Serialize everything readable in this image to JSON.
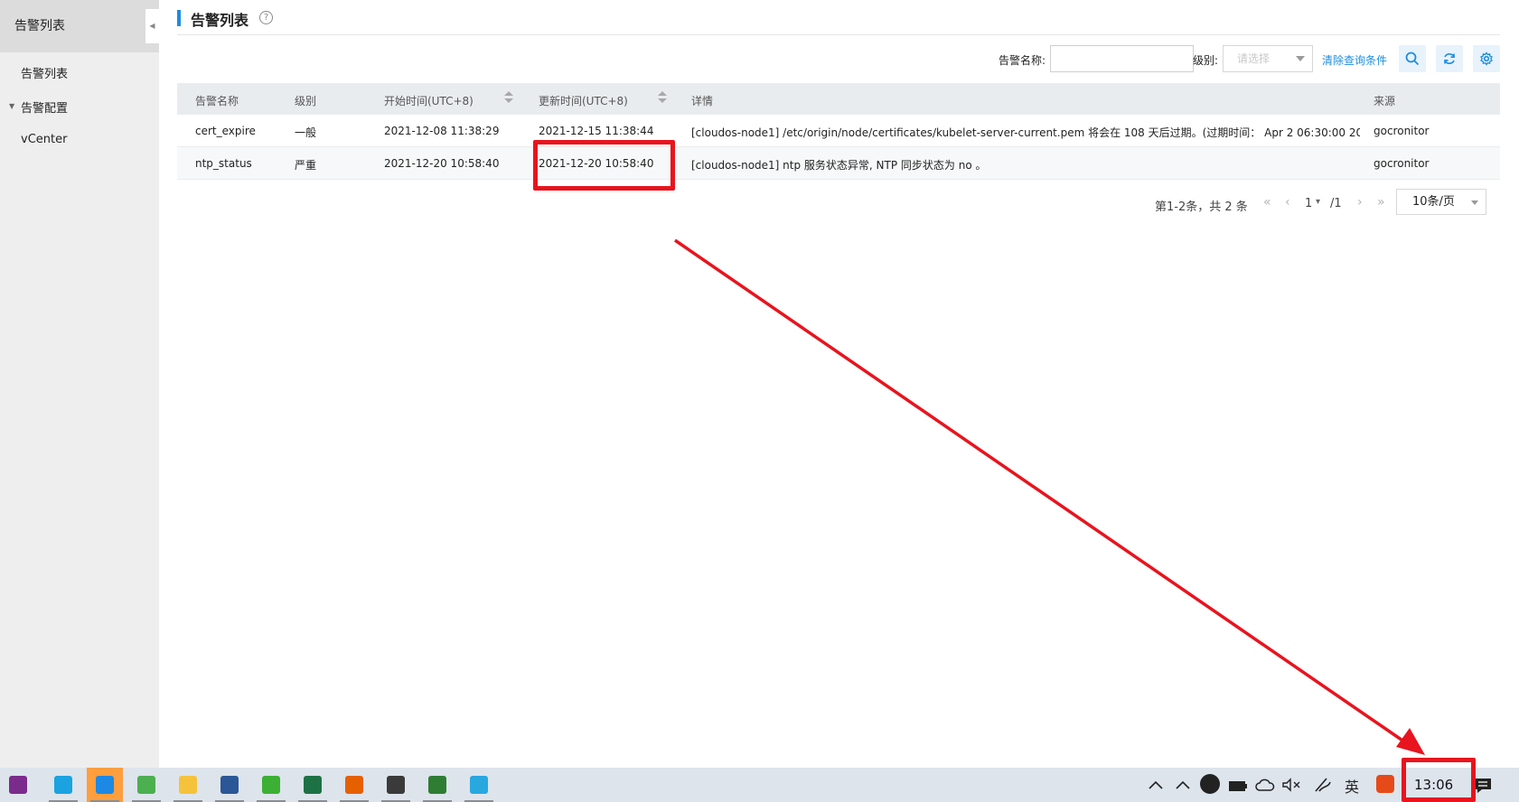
{
  "sidebar": {
    "title": "告警列表",
    "items": [
      {
        "label": "告警列表"
      },
      {
        "label": "告警配置"
      },
      {
        "label": "vCenter"
      }
    ]
  },
  "header": {
    "title": "告警列表",
    "help_glyph": "?"
  },
  "toolbar": {
    "name_label": "告警名称:",
    "name_value": "",
    "level_label": "级别:",
    "level_placeholder": "请选择",
    "clear_label": "清除查询条件",
    "buttons": [
      "search-icon",
      "refresh-icon",
      "gear-icon"
    ]
  },
  "table": {
    "columns": [
      {
        "label": "告警名称",
        "sortable": false
      },
      {
        "label": "级别",
        "sortable": false
      },
      {
        "label": "开始时间(UTC+8)",
        "sortable": true
      },
      {
        "label": "更新时间(UTC+8)",
        "sortable": true
      },
      {
        "label": "详情",
        "sortable": false
      },
      {
        "label": "来源",
        "sortable": false
      }
    ],
    "rows": [
      {
        "name": "cert_expire",
        "level": "一般",
        "start": "2021-12-08 11:38:29",
        "update": "2021-12-15 11:38:44",
        "detail": "[cloudos-node1] /etc/origin/node/certificates/kubelet-server-current.pem 将会在 108 天后过期。(过期时间： Apr 2 06:30:00 20...",
        "source": "gocronitor"
      },
      {
        "name": "ntp_status",
        "level": "严重",
        "start": "2021-12-20 10:58:40",
        "update": "2021-12-20 10:58:40",
        "detail": "[cloudos-node1] ntp 服务状态异常, NTP 同步状态为 no 。",
        "source": "gocronitor"
      }
    ]
  },
  "pagination": {
    "summary": "第1-2条，共 2 条",
    "first": "«",
    "prev": "‹",
    "page": "1",
    "total": "/1",
    "next": "›",
    "last": "»",
    "page_size": "10条/页"
  },
  "annotation": {
    "color": "#e8141e"
  },
  "taskbar": {
    "apps": [
      {
        "name": "onenote-icon",
        "color": "#7b2b8c"
      },
      {
        "name": "skype-icon",
        "color": "#1aa3e0"
      },
      {
        "name": "qq-browser-icon",
        "color": "#1e88e5",
        "active": true
      },
      {
        "name": "notepad-icon",
        "color": "#4caf50"
      },
      {
        "name": "file-explorer-icon",
        "color": "#f5c33b"
      },
      {
        "name": "word-icon",
        "color": "#2b5797"
      },
      {
        "name": "wechat-icon",
        "color": "#3cb034"
      },
      {
        "name": "excel-icon",
        "color": "#1e7145"
      },
      {
        "name": "firefox-icon",
        "color": "#e66000"
      },
      {
        "name": "remote-desktop-icon",
        "color": "#3a3a3a"
      },
      {
        "name": "security-shield-icon",
        "color": "#2e7d32"
      },
      {
        "name": "xshell-icon",
        "color": "#29a8e0"
      }
    ],
    "tray": {
      "ime_label": "英",
      "clock": "13:06"
    }
  }
}
